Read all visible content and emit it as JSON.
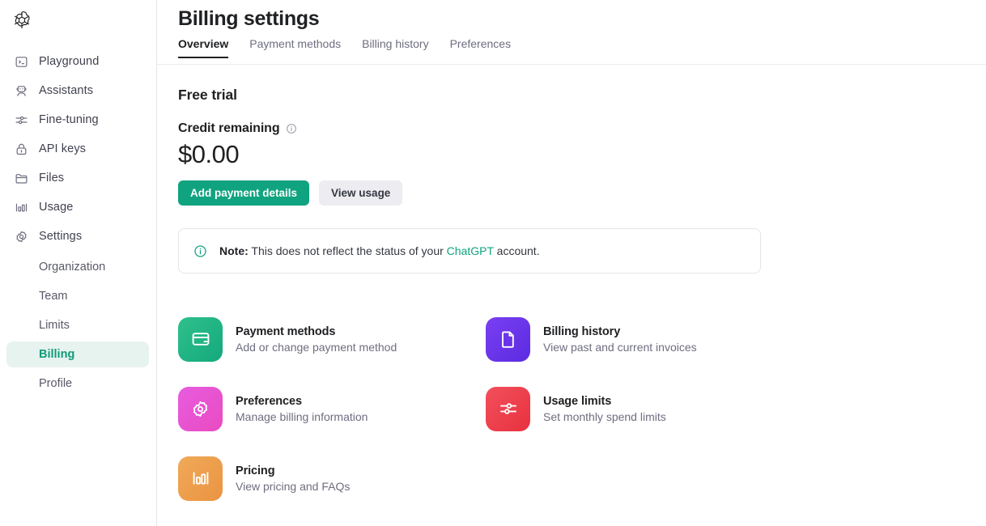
{
  "brand": {
    "logo_name": "openai-logo",
    "accent_green": "#10a37f",
    "active_nav_bg": "#e7f3ef",
    "active_nav_text": "#0f9b78"
  },
  "sidebar": {
    "items": [
      {
        "label": "Playground",
        "icon": "terminal-icon"
      },
      {
        "label": "Assistants",
        "icon": "robot-icon"
      },
      {
        "label": "Fine-tuning",
        "icon": "sliders-icon"
      },
      {
        "label": "API keys",
        "icon": "lock-icon"
      },
      {
        "label": "Files",
        "icon": "folder-icon"
      },
      {
        "label": "Usage",
        "icon": "bar-chart-icon"
      },
      {
        "label": "Settings",
        "icon": "gear-icon"
      }
    ],
    "subitems": [
      {
        "label": "Organization",
        "active": false
      },
      {
        "label": "Team",
        "active": false
      },
      {
        "label": "Limits",
        "active": false
      },
      {
        "label": "Billing",
        "active": true
      },
      {
        "label": "Profile",
        "active": false
      }
    ]
  },
  "header": {
    "title": "Billing settings",
    "tabs": [
      {
        "label": "Overview",
        "active": true
      },
      {
        "label": "Payment methods",
        "active": false
      },
      {
        "label": "Billing history",
        "active": false
      },
      {
        "label": "Preferences",
        "active": false
      }
    ]
  },
  "overview": {
    "section_title": "Free trial",
    "credit_label": "Credit remaining",
    "credit_info_icon": "info-circle-icon",
    "credit_amount": "$0.00",
    "primary_button": "Add payment details",
    "secondary_button": "View usage"
  },
  "note": {
    "icon": "info-circle-icon",
    "prefix": "Note:",
    "text_before": " This does not reflect the status of your ",
    "link": "ChatGPT",
    "text_after": " account."
  },
  "cards": [
    {
      "title": "Payment methods",
      "subtitle": "Add or change payment method",
      "icon": "credit-card-icon",
      "color": "#2fc18c"
    },
    {
      "title": "Billing history",
      "subtitle": "View past and current invoices",
      "icon": "document-icon",
      "color": "#7a3ff2"
    },
    {
      "title": "Preferences",
      "subtitle": "Manage billing information",
      "icon": "gear-icon",
      "color": "#e85ce0"
    },
    {
      "title": "Usage limits",
      "subtitle": "Set monthly spend limits",
      "icon": "sliders-icon",
      "color": "#f2505c"
    },
    {
      "title": "Pricing",
      "subtitle": "View pricing and FAQs",
      "icon": "bar-chart-icon",
      "color": "#f0a958"
    }
  ]
}
